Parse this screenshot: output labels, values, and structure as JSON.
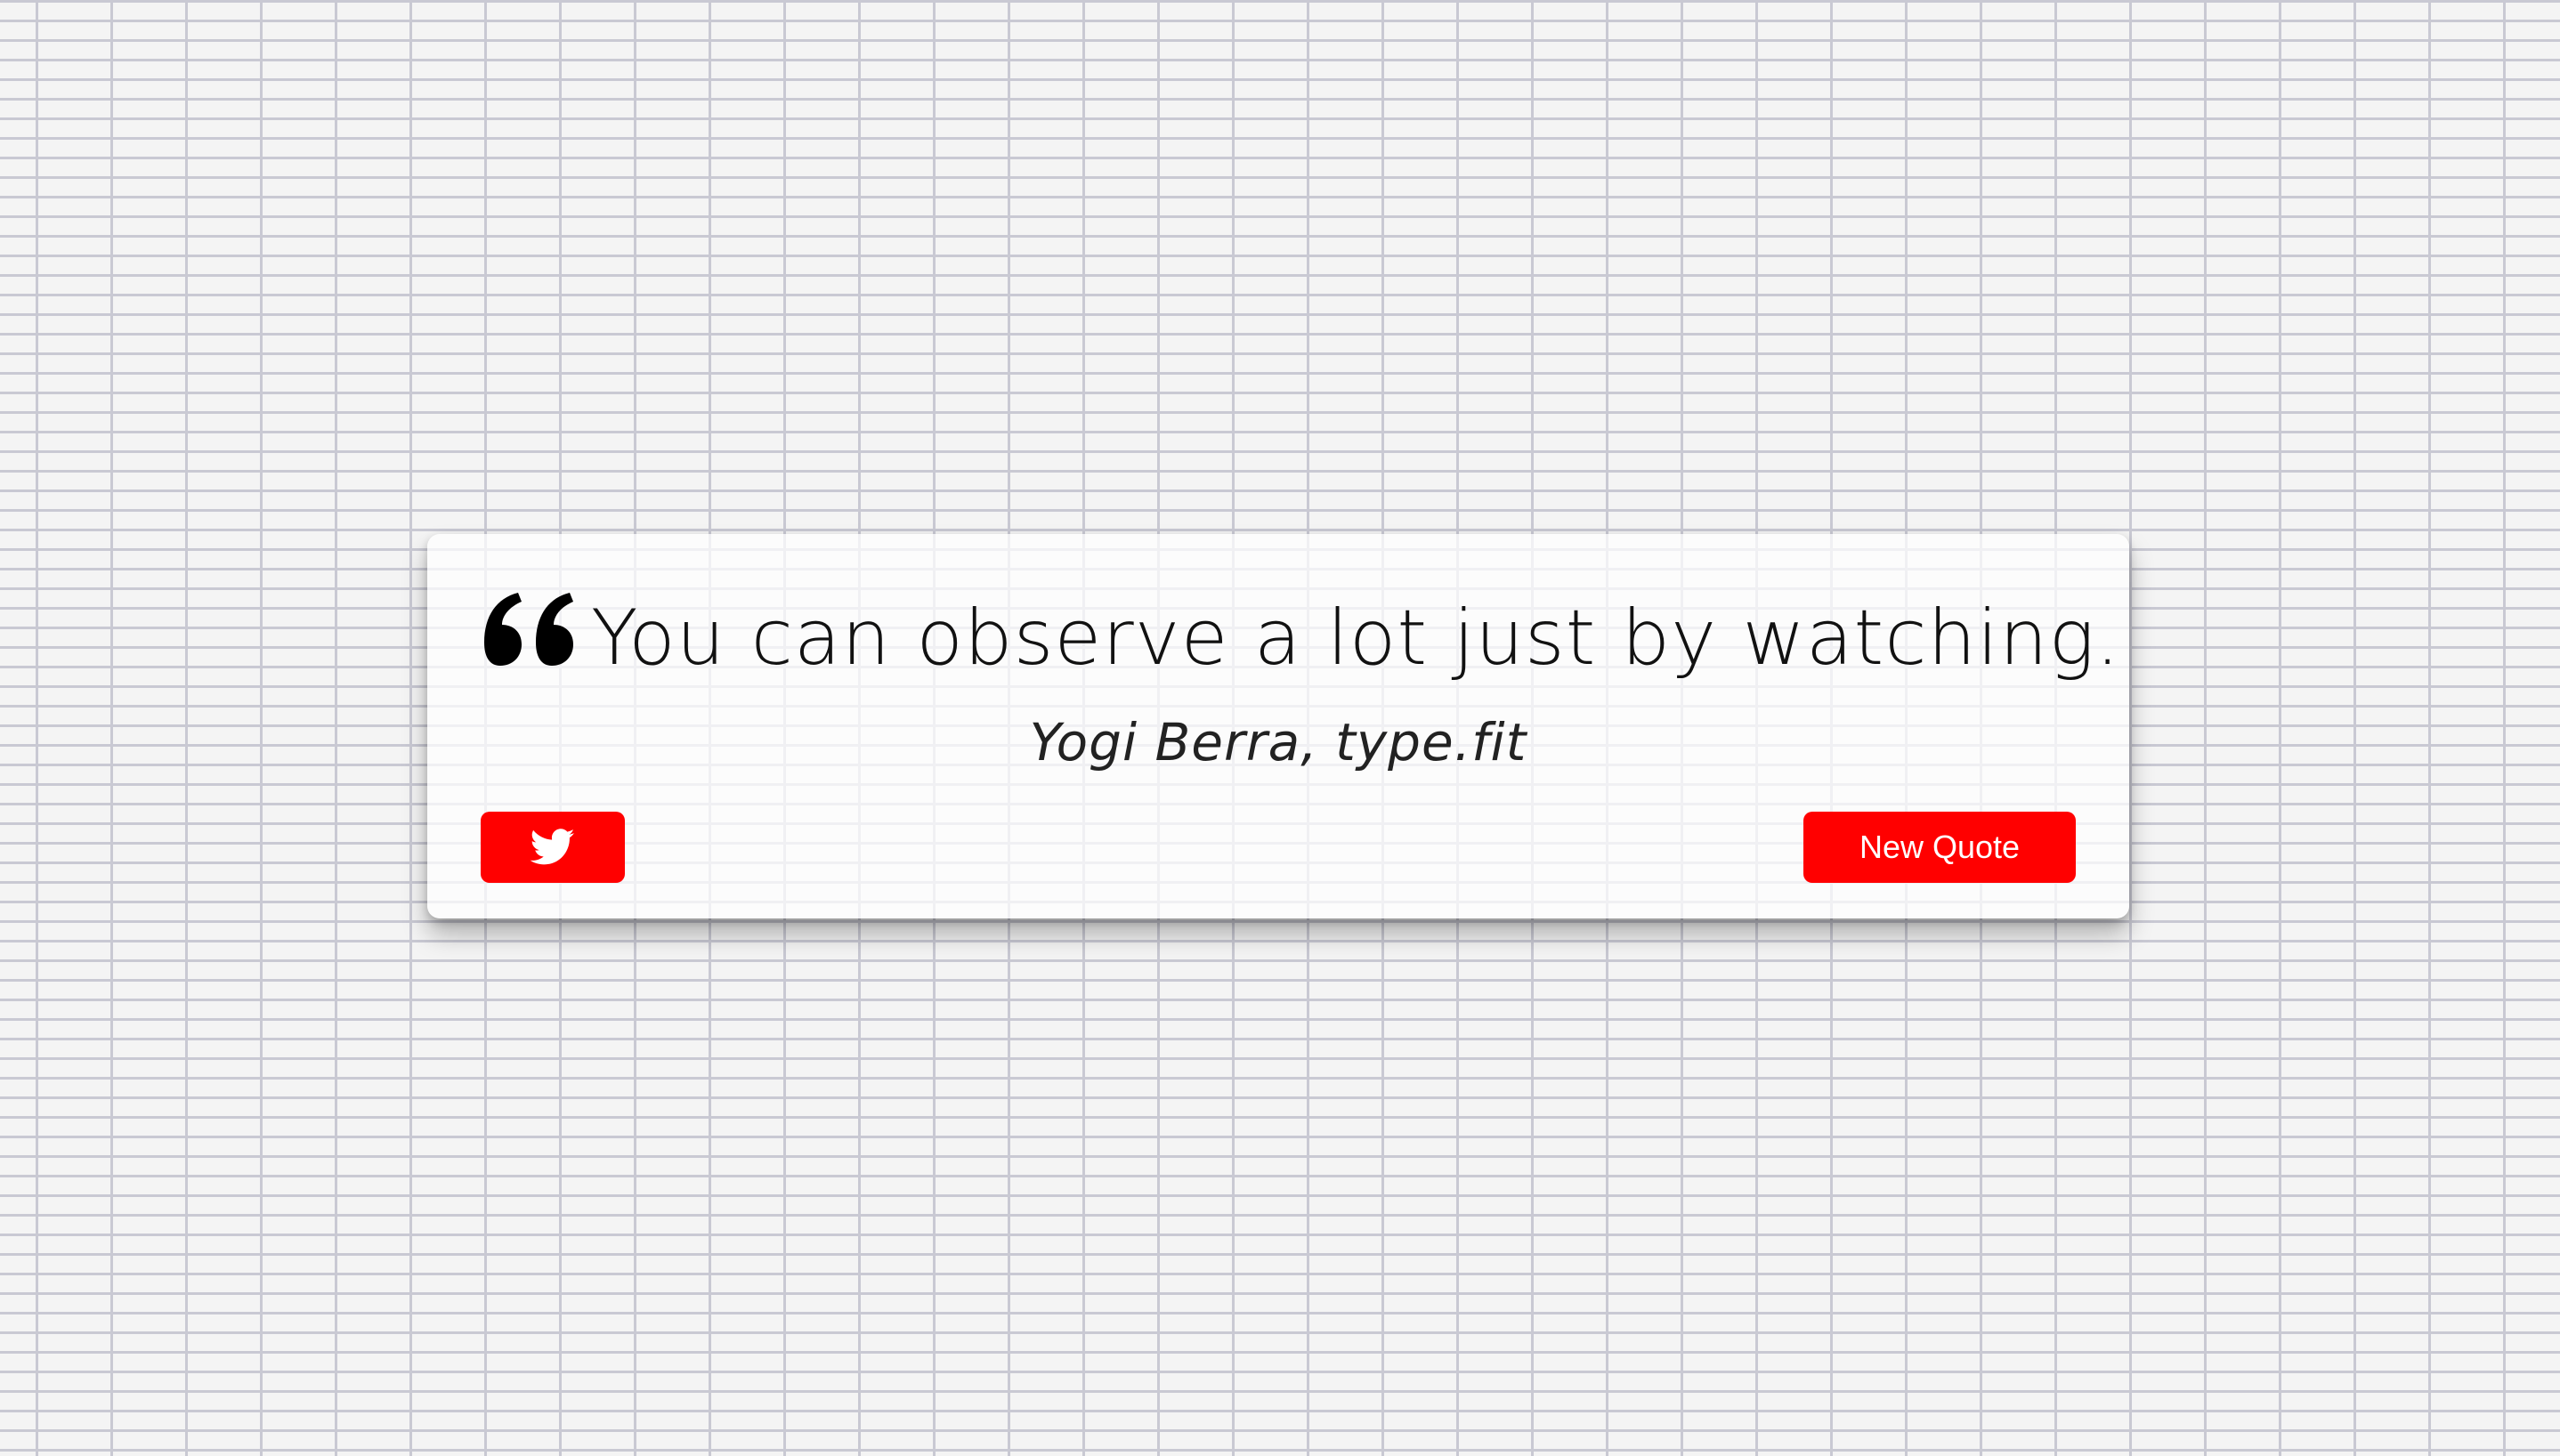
{
  "quote": {
    "text": "You can observe a lot just by watching.",
    "author": "Yogi Berra, type.fit"
  },
  "buttons": {
    "tweet_icon": "twitter-icon",
    "new_quote_label": "New Quote"
  },
  "colors": {
    "accent": "#ff0000",
    "wall_mortar": "#c9c9d3",
    "wall_brick": "#f4f4f4"
  },
  "icons": {
    "quote": "quote-left-icon",
    "tweet": "twitter-icon"
  }
}
